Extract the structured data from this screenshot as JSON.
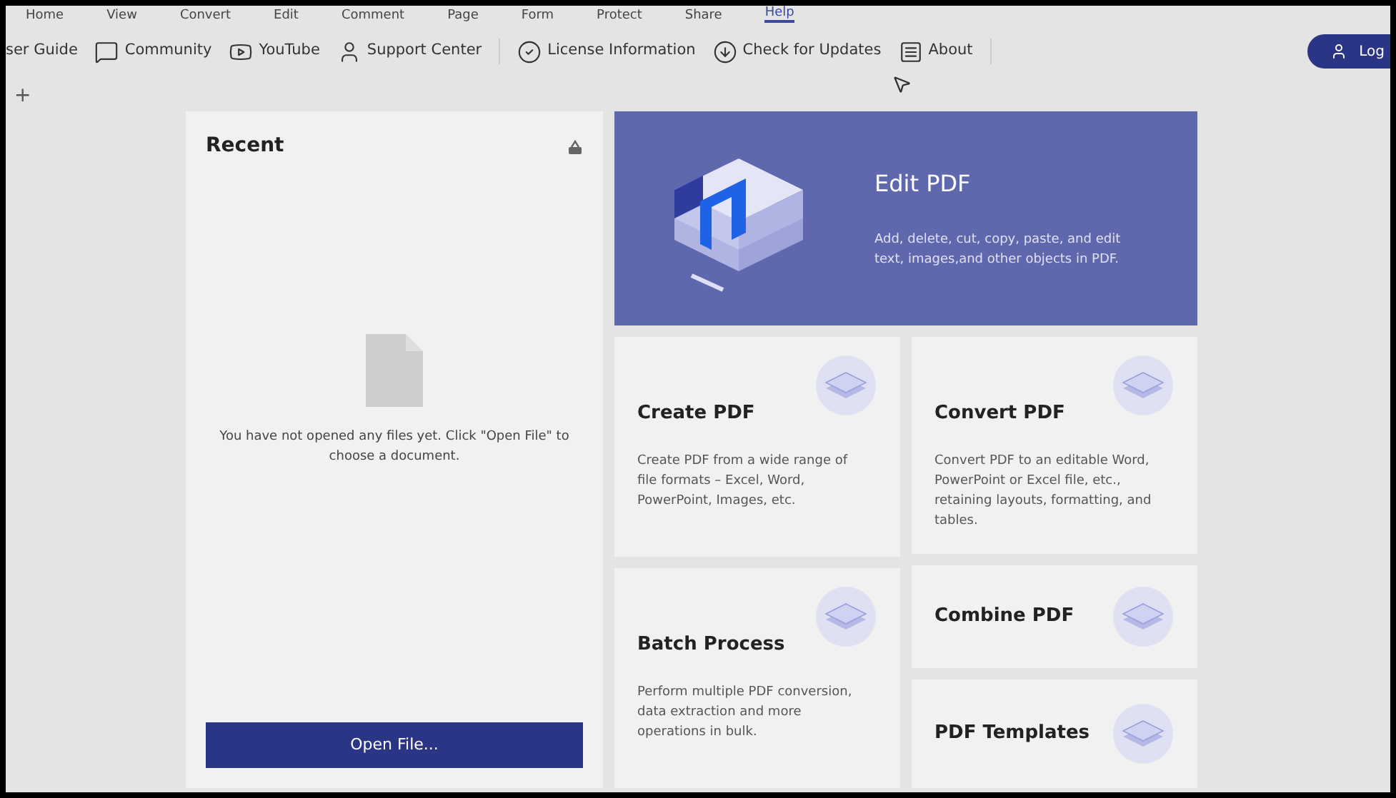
{
  "menu": [
    {
      "label": "Home",
      "selected": false
    },
    {
      "label": "View",
      "selected": false
    },
    {
      "label": "Convert",
      "selected": false
    },
    {
      "label": "Edit",
      "selected": false
    },
    {
      "label": "Comment",
      "selected": false
    },
    {
      "label": "Page",
      "selected": false
    },
    {
      "label": "Form",
      "selected": false
    },
    {
      "label": "Protect",
      "selected": false
    },
    {
      "label": "Share",
      "selected": false
    },
    {
      "label": "Help",
      "selected": true
    }
  ],
  "toolbar": [
    {
      "label": "ser Guide",
      "kind": "none"
    },
    {
      "label": "Community",
      "kind": "community"
    },
    {
      "label": "YouTube",
      "kind": "youtube"
    },
    {
      "label": "Support Center",
      "kind": "person"
    },
    {
      "label": "License Information",
      "kind": "license",
      "group_start": true
    },
    {
      "label": "Check for Updates",
      "kind": "update"
    },
    {
      "label": "About",
      "kind": "about"
    }
  ],
  "login": {
    "label": "Log"
  },
  "new_tab": {
    "label": "+"
  },
  "recent": {
    "title": "Recent",
    "empty_message": "You have not opened any files yet. Click \"Open File\" to choose a document.",
    "open_button": "Open File..."
  },
  "feature_cards": [
    {
      "kind": "hero",
      "title": "Edit PDF",
      "description": "Add, delete, cut, copy, paste, and edit text, images,and other objects in PDF."
    },
    {
      "kind": "card",
      "title": "Create PDF",
      "description": "Create PDF from a wide range of file formats – Excel, Word, PowerPoint, Images, etc."
    },
    {
      "kind": "card",
      "title": "Convert PDF",
      "description": "Convert PDF to an editable Word, PowerPoint or Excel file, etc., retaining layouts, formatting, and tables."
    },
    {
      "kind": "card",
      "title": "Batch Process",
      "description": "Perform multiple PDF conversion, data extraction and more operations in bulk."
    },
    {
      "kind": "small",
      "title": "Combine PDF"
    },
    {
      "kind": "small",
      "title": "PDF Templates"
    }
  ]
}
